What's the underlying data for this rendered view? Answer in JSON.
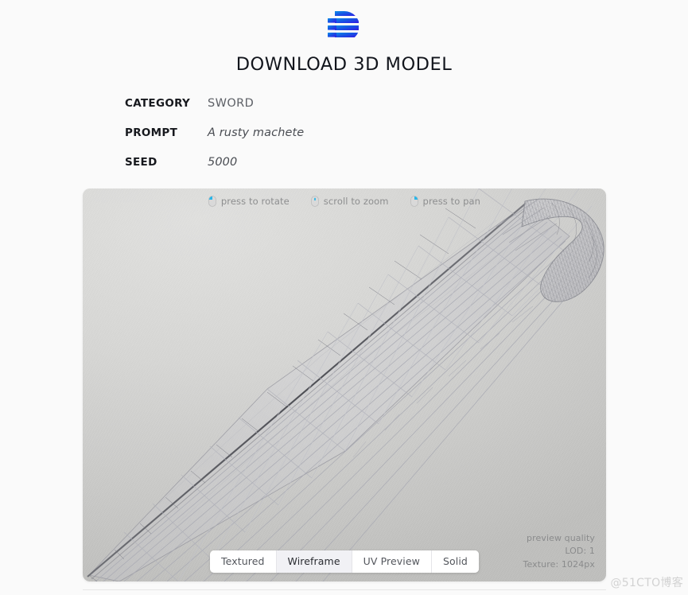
{
  "header": {
    "logo_icon": "brand-logo-icon",
    "title": "DOWNLOAD 3D MODEL"
  },
  "meta": {
    "rows": [
      {
        "label": "CATEGORY",
        "value": "SWORD",
        "style": "plain"
      },
      {
        "label": "PROMPT",
        "value": "A rusty machete",
        "style": "italic"
      },
      {
        "label": "SEED",
        "value": "5000",
        "style": "italic"
      }
    ]
  },
  "viewer": {
    "hints": [
      {
        "icon": "mouse-left-button-icon",
        "label": "press to rotate"
      },
      {
        "icon": "mouse-scroll-wheel-icon",
        "label": "scroll to zoom"
      },
      {
        "icon": "mouse-right-button-icon",
        "label": "press to pan"
      }
    ],
    "quality": {
      "title": "preview quality",
      "lod": "LOD: 1",
      "texture": "Texture: 1024px"
    },
    "modes": [
      {
        "label": "Textured",
        "active": false
      },
      {
        "label": "Wireframe",
        "active": true
      },
      {
        "label": "UV Preview",
        "active": false
      },
      {
        "label": "Solid",
        "active": false
      }
    ],
    "model": "machete-wireframe-mesh"
  },
  "watermark": {
    "text": "@51CTO博客"
  },
  "colors": {
    "page_bg": "#fafafa",
    "title": "#12151c",
    "label": "#16181d",
    "value": "#5d6066",
    "viewer_bg": "#d3d3d1",
    "hint_text": "#8d8e8f",
    "accent_cyan": "#29b6e8",
    "logo_light": "#0a84e0",
    "logo_dark": "#2a1fe0",
    "mode_active_bg": "#f1f1f5",
    "watermark": "#d2d2d2"
  }
}
